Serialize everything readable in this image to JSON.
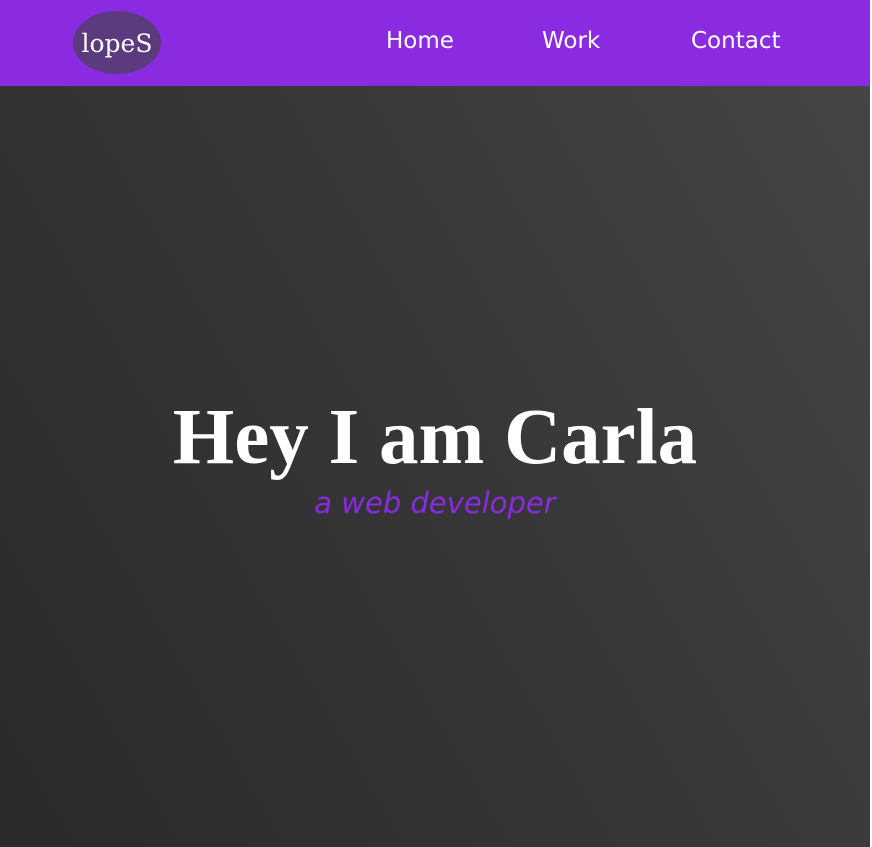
{
  "colors": {
    "nav_background": "#8a2be2",
    "logo_background": "#5b3a7e",
    "hero_gradient_dark": "#2a2a2a",
    "hero_gradient_light": "#454545",
    "title_text": "#ffffff",
    "subtitle_text": "#8a2be2"
  },
  "header": {
    "logo_text": "lopeS",
    "nav": {
      "home": "Home",
      "work": "Work",
      "contact": "Contact"
    }
  },
  "hero": {
    "title": "Hey I am Carla",
    "subtitle": "a web developer"
  }
}
